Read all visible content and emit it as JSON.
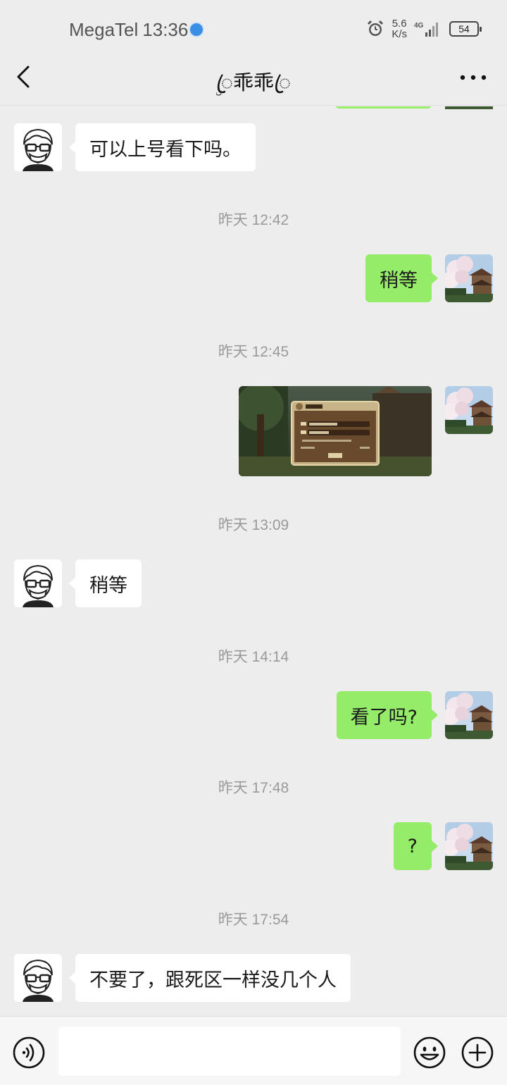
{
  "status_bar": {
    "carrier": "MegaTel",
    "time": "13:36",
    "net_speed_value": "5.6",
    "net_speed_unit": "K/s",
    "network_type": "4G",
    "battery": "54"
  },
  "header": {
    "title": "ۣꦿ乖乖ꦿ"
  },
  "messages": [
    {
      "side": "left",
      "type": "text",
      "text": "可以上号看下吗。"
    },
    {
      "type": "timestamp",
      "text": "昨天 12:42"
    },
    {
      "side": "right",
      "type": "text",
      "text": "稍等"
    },
    {
      "type": "timestamp",
      "text": "昨天 12:45"
    },
    {
      "side": "right",
      "type": "image",
      "description_icon": "game-login-screenshot",
      "login_dialog": {
        "field_account": "帐号",
        "field_password": "密码",
        "account_value": "omg162520999",
        "password_value": "Love11037",
        "button": "登录"
      }
    },
    {
      "type": "timestamp",
      "text": "昨天 13:09"
    },
    {
      "side": "left",
      "type": "text",
      "text": "稍等"
    },
    {
      "type": "timestamp",
      "text": "昨天 14:14"
    },
    {
      "side": "right",
      "type": "text",
      "text": "看了吗?"
    },
    {
      "type": "timestamp",
      "text": "昨天 17:48"
    },
    {
      "side": "right",
      "type": "text",
      "text": "?"
    },
    {
      "type": "timestamp",
      "text": "昨天 17:54"
    },
    {
      "side": "left",
      "type": "text",
      "text": "不要了，跟死区一样没几个人"
    }
  ],
  "input_bar": {
    "placeholder": ""
  },
  "icons": {
    "back": "chevron-left-icon",
    "more": "more-dots-icon",
    "voice": "voice-icon",
    "emoji": "emoji-icon",
    "plus": "plus-icon"
  },
  "colors": {
    "background": "#ededed",
    "bubble_self": "#95ec69",
    "bubble_other": "#ffffff",
    "timestamp": "#9a9a9a"
  }
}
